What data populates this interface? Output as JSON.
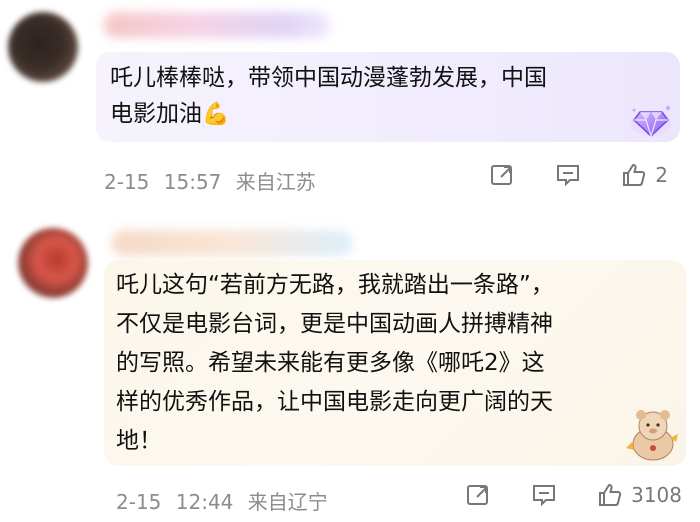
{
  "comments": [
    {
      "text": "吒儿棒棒哒，带领中国动漫蓬勃发展，中国\n电影加油",
      "emoji": "💪",
      "date": "2-15",
      "time": "15:57",
      "location": "来自江苏",
      "likes": "2",
      "icons": {
        "share": "share-icon",
        "reply": "comment-icon",
        "like": "thumbs-up-icon",
        "badge": "diamond-badge-icon"
      }
    },
    {
      "text": "吒儿这句“若前方无路，我就踏出一条路”，\n不仅是电影台词，更是中国动画人拼搏精神\n的写照。希望未来能有更多像《哪吒2》这\n样的优秀作品，让中国电影走向更广阔的天\n地！",
      "date": "2-15",
      "time": "12:44",
      "location": "来自辽宁",
      "likes": "3108",
      "icons": {
        "share": "share-icon",
        "reply": "comment-icon",
        "like": "thumbs-up-icon",
        "sticker": "bear-sticker-icon"
      }
    }
  ],
  "colors": {
    "meta_gray": "#8c8c8c",
    "bubble_purple": "#f1ecfd",
    "bubble_cream": "#fcf6ea"
  }
}
